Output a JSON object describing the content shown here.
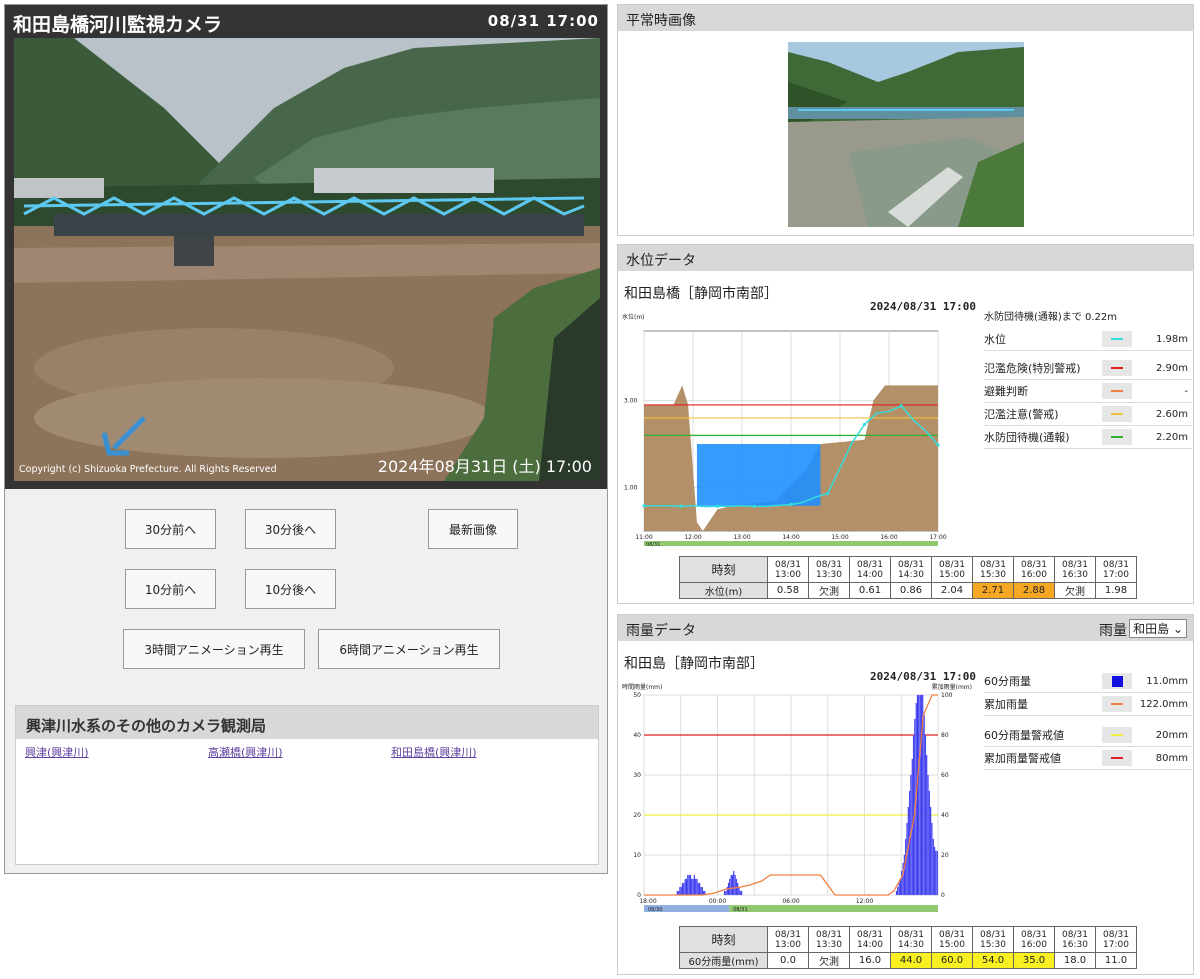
{
  "camera": {
    "title": "和田島橋河川監視カメラ",
    "time": "08/31 17:00",
    "copyright": "Copyright (c) Shizuoka Prefecture. All Rights Reserved",
    "stamp": "2024年08月31日 (土) 17:00"
  },
  "buttons": {
    "back30": "30分前へ",
    "fwd30": "30分後へ",
    "latest": "最新画像",
    "back10": "10分前へ",
    "fwd10": "10分後へ",
    "anim3": "3時間アニメーション再生",
    "anim6": "6時間アニメーション再生"
  },
  "other_cameras": {
    "heading": "興津川水系のその他のカメラ観測局",
    "links": [
      "興津(興津川)",
      "高瀬橋(興津川)",
      "和田島橋(興津川)"
    ]
  },
  "normal": {
    "heading": "平常時画像"
  },
  "water": {
    "heading": "水位データ",
    "station": "和田島橋［静岡市南部］",
    "stamp": "2024/08/31 17:00",
    "note": "水防団待機(通報)まで 0.22m",
    "legend": [
      {
        "label": "水位",
        "value": "1.98m",
        "color": "#33dddd"
      },
      {
        "label": "氾濫危険(特別警戒)",
        "value": "2.90m",
        "color": "#e02020"
      },
      {
        "label": "避難判断",
        "value": "-",
        "color": "#f08040"
      },
      {
        "label": "氾濫注意(警戒)",
        "value": "2.60m",
        "color": "#f0c040"
      },
      {
        "label": "水防団待機(通報)",
        "value": "2.20m",
        "color": "#30b030"
      }
    ],
    "chart_data": {
      "type": "line",
      "ylabel": "水位(m)",
      "yticks": [
        "3.00",
        "1.00"
      ],
      "xticks": [
        "11:00",
        "12:00",
        "13:00",
        "14:00",
        "15:00",
        "16:00",
        "17:00"
      ],
      "date": "08/31",
      "ylim": [
        0,
        4.6
      ],
      "thresholds": [
        2.9,
        2.6,
        2.2
      ],
      "x": [
        "11:00",
        "11:15",
        "11:30",
        "11:45",
        "12:00",
        "12:15",
        "12:30",
        "12:45",
        "13:00",
        "13:15",
        "13:30",
        "13:45",
        "14:00",
        "14:15",
        "14:30",
        "14:45",
        "15:00",
        "15:15",
        "15:30",
        "15:45",
        "16:00",
        "16:15",
        "16:30",
        "16:45",
        "17:00"
      ],
      "values": [
        0.58,
        0.58,
        0.58,
        0.57,
        0.58,
        0.56,
        0.57,
        0.57,
        0.58,
        0.57,
        0.57,
        0.59,
        0.61,
        0.66,
        0.78,
        0.86,
        1.45,
        2.04,
        2.45,
        2.71,
        2.75,
        2.88,
        2.55,
        2.3,
        1.98
      ]
    },
    "table": {
      "head": "時刻",
      "row": "水位(m)",
      "times": [
        "08/31\n13:00",
        "08/31\n13:30",
        "08/31\n14:00",
        "08/31\n14:30",
        "08/31\n15:00",
        "08/31\n15:30",
        "08/31\n16:00",
        "08/31\n16:30",
        "08/31\n17:00"
      ],
      "values": [
        "0.58",
        "欠測",
        "0.61",
        "0.86",
        "2.04",
        "2.71",
        "2.88",
        "欠測",
        "1.98"
      ],
      "highlight": [
        "",
        "",
        "",
        "",
        "",
        "#f5a623",
        "#f5a623",
        "",
        ""
      ]
    }
  },
  "rain": {
    "heading": "雨量データ",
    "selector_label": "雨量",
    "selector_value": "和田島",
    "station": "和田島［静岡市南部］",
    "stamp": "2024/08/31 17:00",
    "legend": [
      {
        "label": "60分雨量",
        "value": "11.0mm",
        "color": "#1010e0"
      },
      {
        "label": "累加雨量",
        "value": "122.0mm",
        "color": "#f08040"
      },
      {
        "label": "60分雨量警戒値",
        "value": "20mm",
        "color": "#f0f040"
      },
      {
        "label": "累加雨量警戒値",
        "value": "80mm",
        "color": "#e02020"
      }
    ],
    "chart_data": {
      "type": "bar",
      "ylabel_left": "時間雨量(mm)",
      "ylabel_right": "累加雨量(mm)",
      "yticks_left": [
        "50",
        "40",
        "30",
        "20",
        "10",
        "0"
      ],
      "yticks_right": [
        "100",
        "80",
        "60",
        "40",
        "20",
        "0"
      ],
      "xticks": [
        "18:00",
        "00:00",
        "06:00",
        "12:00"
      ],
      "dates": [
        "08/30",
        "08/31"
      ],
      "ylim": [
        0,
        50
      ],
      "thresholds": {
        "hourly": 20,
        "cumulative": 80
      },
      "bars": [
        0,
        0,
        0,
        0,
        0,
        0,
        0,
        0,
        0,
        0,
        0,
        0,
        0,
        0,
        0,
        0,
        0,
        0,
        0,
        0,
        0,
        0,
        0,
        0,
        0,
        1,
        1,
        2,
        2,
        3,
        3,
        4,
        4,
        5,
        5,
        5,
        4,
        4,
        5,
        4,
        4,
        3,
        3,
        2,
        2,
        1,
        1,
        0,
        0,
        0,
        0,
        0,
        0,
        0,
        0,
        0,
        0,
        0,
        0,
        0,
        0,
        1,
        1,
        2,
        3,
        4,
        5,
        5,
        6,
        5,
        4,
        3,
        2,
        1,
        1,
        0,
        0,
        0,
        0,
        0,
        0,
        0,
        0,
        0,
        0,
        0,
        0,
        0,
        0,
        0,
        0,
        0,
        0,
        0,
        0,
        0,
        0,
        0,
        0,
        0,
        0,
        0,
        0,
        0,
        0,
        0,
        0,
        0,
        0,
        0,
        0,
        0,
        0,
        0,
        0,
        0,
        0,
        0,
        0,
        0,
        0,
        0,
        0,
        0,
        0,
        0,
        0,
        0,
        0,
        0,
        0,
        0,
        0,
        0,
        0,
        0,
        0,
        0,
        0,
        0,
        0,
        0,
        0,
        0,
        0,
        0,
        0,
        0,
        0,
        0,
        0,
        0,
        0,
        0,
        0,
        0,
        0,
        0,
        0,
        0,
        0,
        0,
        0,
        0,
        0,
        0,
        0,
        0,
        0,
        0,
        0,
        0,
        0,
        0,
        0,
        0,
        0,
        0,
        0,
        0,
        0,
        0,
        0,
        0,
        0,
        0,
        0,
        0,
        0,
        0,
        0,
        0,
        1,
        2,
        3,
        4,
        6,
        8,
        10,
        14,
        18,
        22,
        26,
        30,
        34,
        40,
        44,
        48,
        52,
        54,
        54,
        52,
        50,
        45,
        40,
        35,
        30,
        26,
        22,
        18,
        14,
        12,
        11,
        11
      ],
      "cumulative": [
        [
          0,
          0
        ],
        [
          0.2,
          0
        ],
        [
          0.24,
          1
        ],
        [
          0.28,
          3
        ],
        [
          0.33,
          4
        ],
        [
          0.36,
          5
        ],
        [
          0.4,
          7
        ],
        [
          0.43,
          10
        ],
        [
          0.5,
          10
        ],
        [
          0.58,
          10
        ],
        [
          0.6,
          10
        ],
        [
          0.65,
          0
        ],
        [
          0.83,
          0
        ],
        [
          0.85,
          2
        ],
        [
          0.88,
          10
        ],
        [
          0.92,
          40
        ],
        [
          0.95,
          90
        ],
        [
          0.98,
          115
        ],
        [
          1.0,
          122
        ]
      ]
    },
    "table": {
      "head": "時刻",
      "row": "60分雨量(mm)",
      "times": [
        "08/31\n13:00",
        "08/31\n13:30",
        "08/31\n14:00",
        "08/31\n14:30",
        "08/31\n15:00",
        "08/31\n15:30",
        "08/31\n16:00",
        "08/31\n16:30",
        "08/31\n17:00"
      ],
      "values": [
        "0.0",
        "欠測",
        "16.0",
        "44.0",
        "60.0",
        "54.0",
        "35.0",
        "18.0",
        "11.0"
      ],
      "highlight": [
        "",
        "",
        "",
        "#f8f020",
        "#f8f020",
        "#f8f020",
        "#f8f020",
        "",
        ""
      ]
    }
  }
}
